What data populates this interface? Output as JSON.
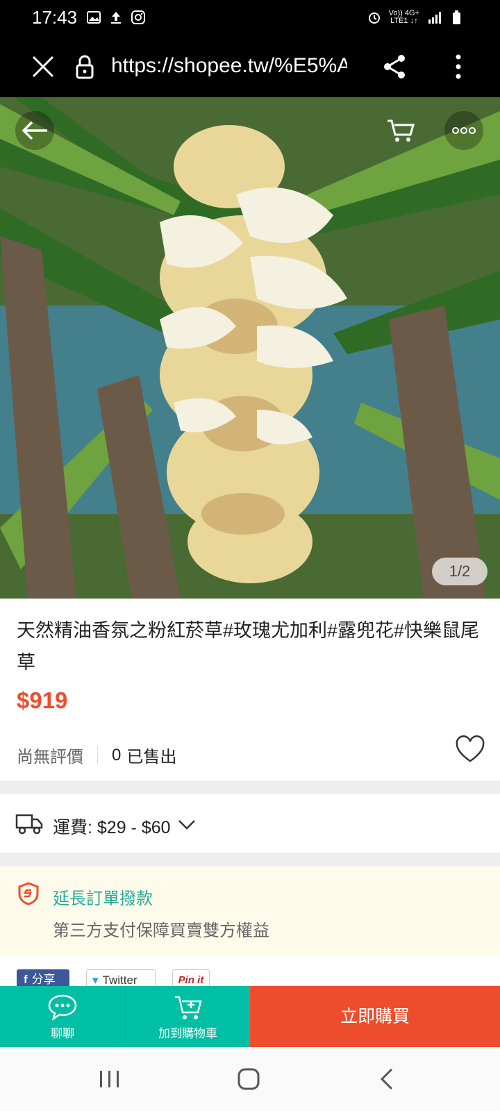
{
  "status_bar": {
    "time": "17:43",
    "left_icons": [
      "image-icon",
      "upload-icon",
      "instagram-icon"
    ],
    "right_icons": [
      "alarm-icon",
      "volte-icon",
      "4g-icon",
      "signal-icon",
      "battery-icon"
    ],
    "network_top": "Vo)) 4G+",
    "network_bottom": "LTE1 ↓↑"
  },
  "browser": {
    "url": "https://shopee.tw/%E5%A"
  },
  "gallery": {
    "counter": "1/2"
  },
  "product": {
    "title": "天然精油香氛之粉紅菸草#玫瑰尤加利#露兜花#快樂鼠尾草",
    "price": "$919",
    "rating_text": "尚無評價",
    "sold_count": "0",
    "sold_label": "已售出"
  },
  "shipping": {
    "label": "運費: $29 - $60"
  },
  "guarantee": {
    "title": "延長訂單撥款",
    "subtitle": "第三方支付保障買賣雙方權益"
  },
  "social": {
    "facebook": "分享",
    "twitter": "Twitter",
    "pinterest": "Pin it"
  },
  "actions": {
    "chat": "聊聊",
    "add_to_cart": "加到購物車",
    "buy_now": "立即購買"
  },
  "colors": {
    "accent": "#ee4d2d",
    "teal": "#00bfa5",
    "guarantee_green": "#26aa99"
  }
}
